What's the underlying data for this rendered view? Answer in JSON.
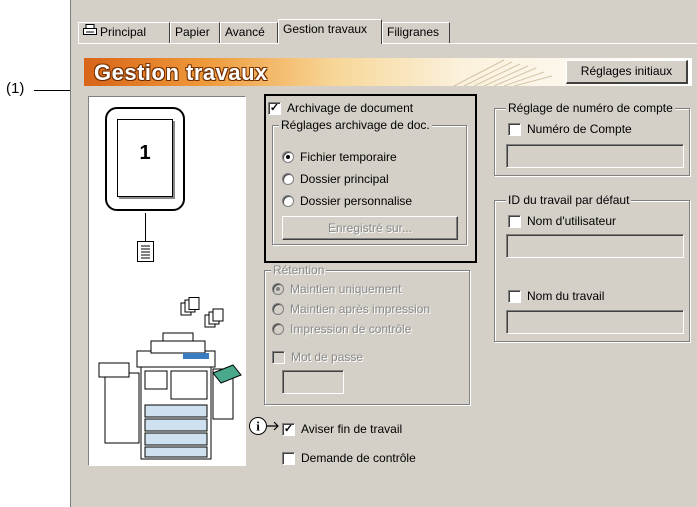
{
  "annotation": {
    "callout": "(1)"
  },
  "tabs": [
    {
      "label": "Principal",
      "icon": "printer-icon",
      "active": false
    },
    {
      "label": "Papier",
      "active": false
    },
    {
      "label": "Avancé",
      "active": false
    },
    {
      "label": "Gestion travaux",
      "active": true
    },
    {
      "label": "Filigranes",
      "active": false
    }
  ],
  "header": {
    "title": "Gestion travaux",
    "reset_button": "Réglages initiaux",
    "colors": {
      "band_start": "#d86418",
      "band_end": "#ffffff"
    }
  },
  "preview": {
    "page_number": "1"
  },
  "archive": {
    "checkbox_label": "Archivage de document",
    "checked": true,
    "settings_title": "Réglages archivage de doc.",
    "options": [
      {
        "label": "Fichier temporaire",
        "selected": true
      },
      {
        "label": "Dossier principal",
        "selected": false
      },
      {
        "label": "Dossier personnalise",
        "selected": false
      }
    ],
    "registered_button": "Enregistré sur..."
  },
  "retention": {
    "title": "Rétention",
    "options": [
      {
        "label": "Maintien uniquement",
        "selected": true
      },
      {
        "label": "Maintien après impression",
        "selected": false
      },
      {
        "label": "Impression de contrôle",
        "selected": false
      }
    ],
    "password_label": "Mot de passe",
    "password_value": ""
  },
  "notify": {
    "end_of_job_label": "Aviser fin de travail",
    "end_of_job_checked": true,
    "check_request_label": "Demande de contrôle",
    "check_request_checked": false
  },
  "account": {
    "title": "Réglage de numéro de compte",
    "checkbox_label": "Numéro de Compte",
    "value": ""
  },
  "job_id": {
    "title": "ID du travail par défaut",
    "username_label": "Nom d'utilisateur",
    "username_value": "",
    "jobname_label": "Nom du travail",
    "jobname_value": ""
  }
}
